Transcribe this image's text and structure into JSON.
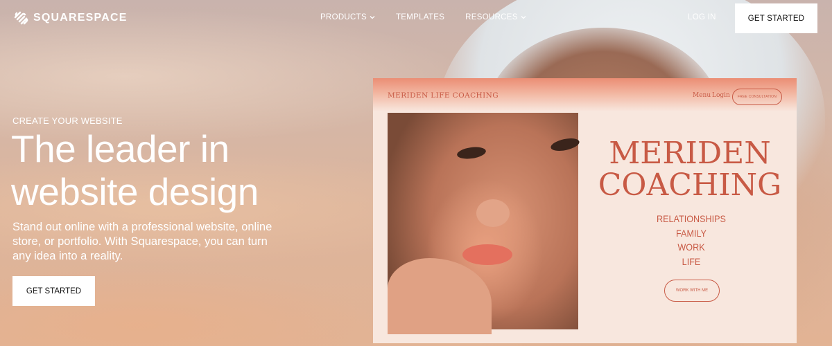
{
  "nav": {
    "logo_text": "SQUARESPACE",
    "links": [
      {
        "label": "PRODUCTS",
        "has_dropdown": true
      },
      {
        "label": "TEMPLATES",
        "has_dropdown": false
      },
      {
        "label": "RESOURCES",
        "has_dropdown": true
      }
    ],
    "login_label": "LOG IN",
    "cta_label": "GET STARTED"
  },
  "hero": {
    "eyebrow": "CREATE YOUR WEBSITE",
    "headline": "The leader in website design",
    "subtext": "Stand out online with a professional website, online store, or portfolio. With Squarespace, you can turn any idea into a reality.",
    "cta_label": "GET STARTED"
  },
  "mockup": {
    "brand": "MERIDEN LIFE COACHING",
    "menu_label": "Menu",
    "login_label": "Login",
    "consult_label": "FREE CONSULTATION",
    "title_lines": [
      "MERIDEN",
      "COACHING"
    ],
    "list": [
      "RELATIONSHIPS",
      "FAMILY",
      "WORK",
      "LIFE"
    ],
    "work_label": "WORK WITH ME",
    "accent_color": "#c85a45"
  }
}
